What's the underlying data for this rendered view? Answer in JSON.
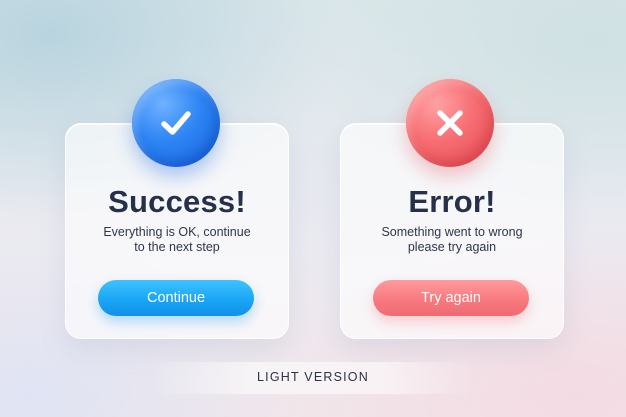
{
  "success_card": {
    "title": "Success!",
    "description_line1": "Everything is OK, continue",
    "description_line2": "to the next step",
    "button_label": "Continue",
    "icon": "check-icon",
    "accent_color": "#2d84f4",
    "button_color": "#1aa6f5"
  },
  "error_card": {
    "title": "Error!",
    "description_line1": "Something went to wrong",
    "description_line2": "please try again",
    "button_label": "Try again",
    "icon": "close-icon",
    "accent_color": "#f66d72",
    "button_color": "#f8797f"
  },
  "footer": {
    "label": "LIGHT VERSION"
  }
}
